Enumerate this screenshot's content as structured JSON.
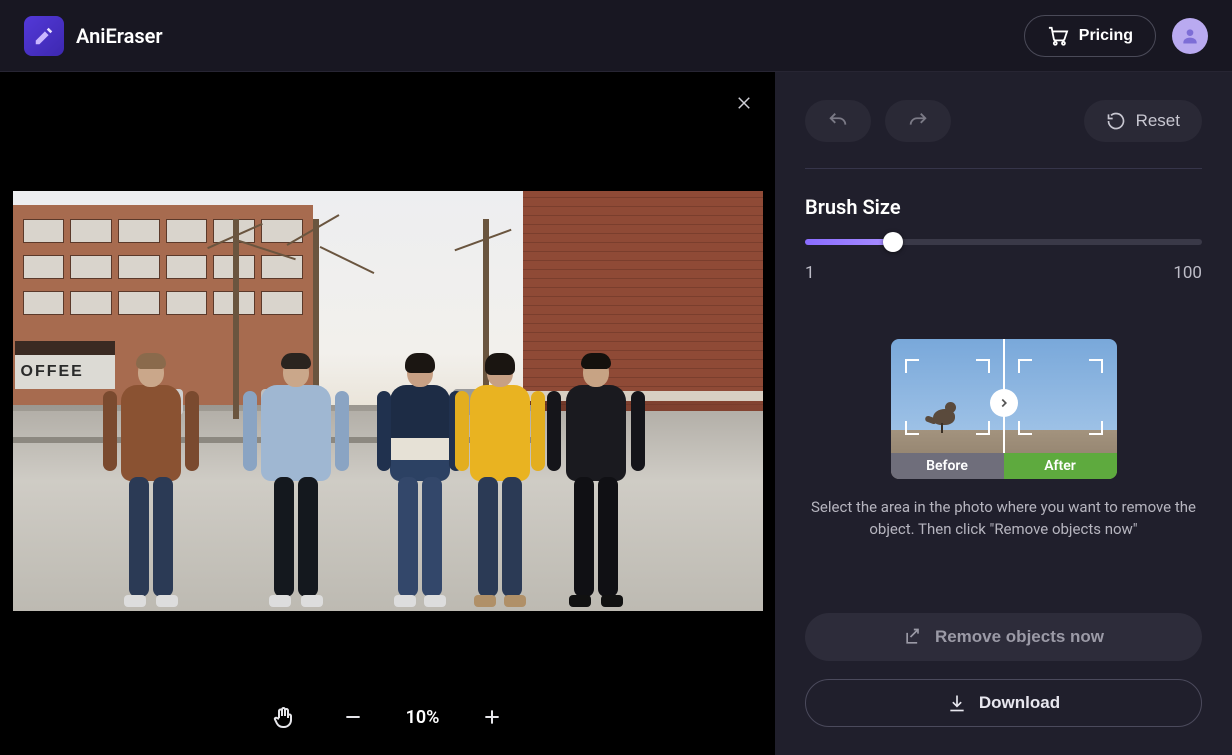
{
  "header": {
    "app_name": "AniEraser",
    "pricing_label": "Pricing"
  },
  "canvas": {
    "sign_text": "OFFEE",
    "zoom": {
      "value": "10%"
    }
  },
  "panel": {
    "reset_label": "Reset",
    "brush": {
      "title": "Brush Size",
      "min_label": "1",
      "max_label": "100",
      "min": 1,
      "max": 100,
      "value": 23
    },
    "example": {
      "before_label": "Before",
      "after_label": "After"
    },
    "hint": "Select the area in the photo where you want to remove the object. Then click \"Remove objects now\"",
    "remove_label": "Remove objects now",
    "download_label": "Download"
  }
}
